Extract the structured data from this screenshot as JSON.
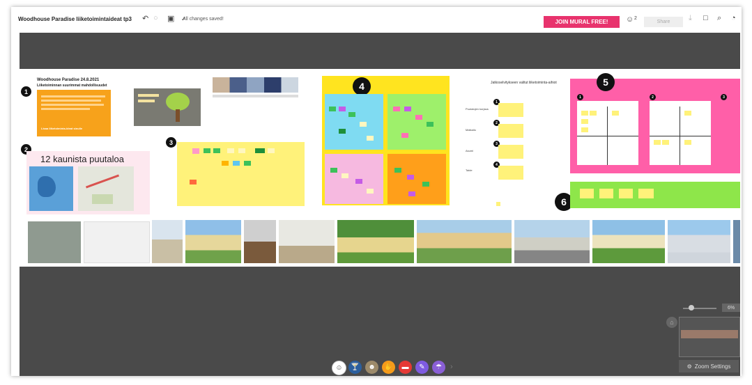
{
  "header": {
    "title": "Woodhouse Paradise liiketoimintaideat tp3",
    "saved_status": "All changes saved!",
    "join_label": "JOIN MURAL FREE!",
    "collaborators_count": "2",
    "share_label": "Share"
  },
  "board": {
    "section1": {
      "number": "1",
      "title": "Woodhouse Paradise 24.8.2021",
      "subtitle": "Liiketoiminnan suurimmat mahdollisuudet",
      "footer": "Lisaa liiketoiminta-ideat sinulle"
    },
    "section2": {
      "number": "2",
      "heading": "12 kaunista puutaloa"
    },
    "section3": {
      "number": "3"
    },
    "section4": {
      "number": "4"
    },
    "section5": {
      "number": "5",
      "cols": [
        "1",
        "2",
        "3"
      ]
    },
    "section6": {
      "number": "6"
    },
    "list": {
      "title": "Jatkoselvitykseen valitut liiketoiminta-aihiot",
      "items": [
        {
          "number": "1",
          "label": "Puutalojen korjaus"
        },
        {
          "number": "2",
          "label": "Matkailu"
        },
        {
          "number": "3",
          "label": "Asumi"
        },
        {
          "number": "4",
          "label": "Taide"
        }
      ]
    }
  },
  "zoom": {
    "percent": "6%",
    "settings_label": "Zoom Settings"
  },
  "colors": {
    "join": "#e8336d",
    "canvas_dark": "#4a4a4a",
    "orange": "#f7a21b",
    "yellow": "#ffe45c",
    "pink": "#ff5fa8",
    "green": "#8ee64a"
  }
}
